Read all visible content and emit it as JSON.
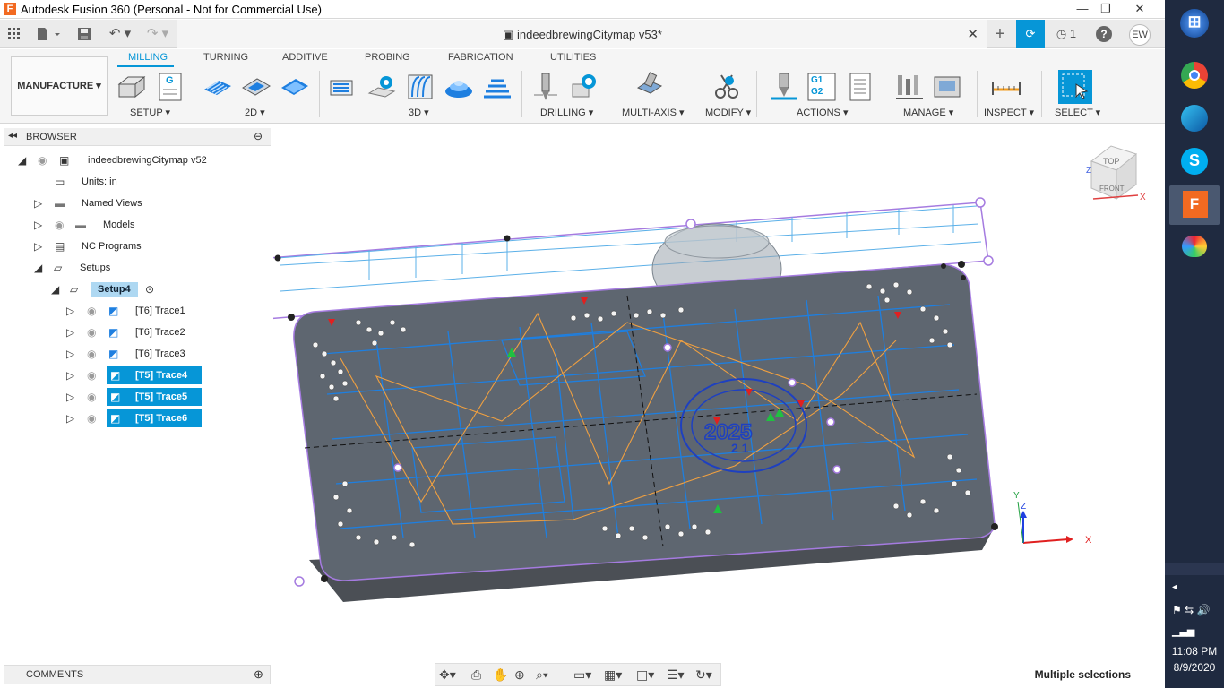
{
  "window": {
    "title": "Autodesk Fusion 360 (Personal - Not for Commercial Use)",
    "app_icon": "F"
  },
  "document": {
    "name": "indeedbrewingCitymap v53*",
    "job_count": "1",
    "user_initials": "EW"
  },
  "ribbon": {
    "workspace": "MANUFACTURE ▾",
    "tabs": [
      "MILLING",
      "TURNING",
      "ADDITIVE",
      "PROBING",
      "FABRICATION",
      "UTILITIES"
    ],
    "active_tab": "MILLING",
    "groups": [
      "SETUP ▾",
      "2D ▾",
      "3D ▾",
      "DRILLING ▾",
      "MULTI-AXIS ▾",
      "MODIFY ▾",
      "ACTIONS ▾",
      "MANAGE ▾",
      "INSPECT ▾",
      "SELECT ▾"
    ],
    "icon_text": {
      "setup_sheet": "G",
      "post": "G1\nG2"
    }
  },
  "browser": {
    "header": "BROWSER",
    "root": "indeedbrewingCitymap v52",
    "units": "Units: in",
    "folders": [
      "Named Views",
      "Models",
      "NC Programs",
      "Setups"
    ],
    "setup": "Setup4",
    "operations": [
      "[T6] Trace1",
      "[T6] Trace2",
      "[T6] Trace3",
      "[T5] Trace4",
      "[T5] Trace5",
      "[T5] Trace6"
    ]
  },
  "viewport": {
    "viewcube": {
      "top": "TOP",
      "front": "FRONT",
      "axis_x": "X",
      "axis_z": "Z"
    },
    "triad": {
      "x": "X",
      "y": "Y",
      "z": "Z"
    },
    "part_text": {
      "year": "2025",
      "sub": "2 1"
    }
  },
  "footer": {
    "comments": "COMMENTS",
    "status": "Multiple selections"
  },
  "taskbar": {
    "time": "11:08 PM",
    "date": "8/9/2020"
  },
  "colors": {
    "accent": "#0696d7",
    "toolpath_blue": "#1e7fe0",
    "toolpath_orange": "#f0a040",
    "stock_outline": "#a57be0",
    "part": "#5e6670"
  }
}
